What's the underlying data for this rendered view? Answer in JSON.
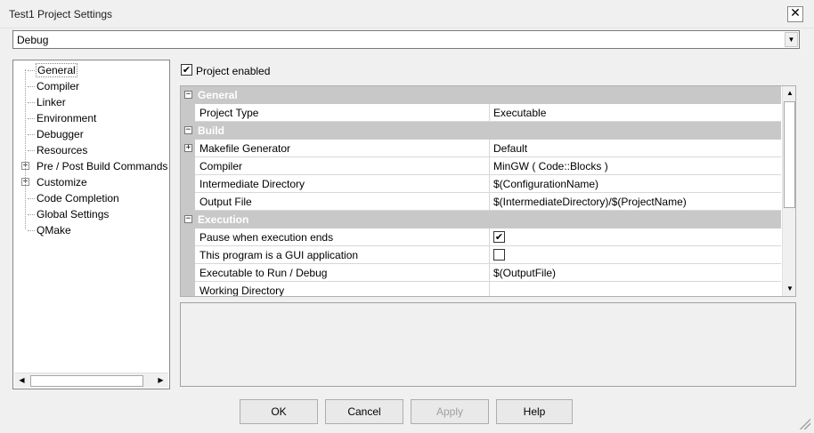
{
  "window": {
    "title": "Test1 Project Settings",
    "close_glyph": "✕"
  },
  "build_target": {
    "selected": "Debug"
  },
  "tree": {
    "items": [
      {
        "label": "General",
        "expandable": false,
        "selected": true
      },
      {
        "label": "Compiler",
        "expandable": false
      },
      {
        "label": "Linker",
        "expandable": false
      },
      {
        "label": "Environment",
        "expandable": false
      },
      {
        "label": "Debugger",
        "expandable": false
      },
      {
        "label": "Resources",
        "expandable": false
      },
      {
        "label": "Pre / Post Build Commands",
        "expandable": true
      },
      {
        "label": "Customize",
        "expandable": true
      },
      {
        "label": "Code Completion",
        "expandable": false
      },
      {
        "label": "Global Settings",
        "expandable": false
      },
      {
        "label": "QMake",
        "expandable": false
      }
    ]
  },
  "project_enabled": {
    "label": "Project enabled",
    "checked": true
  },
  "grid": {
    "rows": [
      {
        "kind": "cat",
        "name": "General",
        "toggle": "−"
      },
      {
        "kind": "prop",
        "name": "Project Type",
        "value": "Executable"
      },
      {
        "kind": "cat",
        "name": "Build",
        "toggle": "−"
      },
      {
        "kind": "prop",
        "name": "Makefile Generator",
        "value": "Default",
        "toggle": "+"
      },
      {
        "kind": "prop",
        "name": "Compiler",
        "value": "MinGW ( Code::Blocks )"
      },
      {
        "kind": "prop",
        "name": "Intermediate Directory",
        "value": "$(ConfigurationName)"
      },
      {
        "kind": "prop",
        "name": "Output File",
        "value": "$(IntermediateDirectory)/$(ProjectName)"
      },
      {
        "kind": "cat",
        "name": "Execution",
        "toggle": "−"
      },
      {
        "kind": "prop",
        "name": "Pause when execution ends",
        "checkbox": true,
        "checked": true
      },
      {
        "kind": "prop",
        "name": "This program is a GUI application",
        "checkbox": true,
        "checked": false
      },
      {
        "kind": "prop",
        "name": "Executable to Run / Debug",
        "value": "$(OutputFile)"
      },
      {
        "kind": "prop",
        "name": "Working Directory",
        "value": ""
      }
    ]
  },
  "buttons": {
    "ok": "OK",
    "cancel": "Cancel",
    "apply": "Apply",
    "help": "Help"
  },
  "icons": {
    "check": "✔",
    "scroll_up": "▲",
    "scroll_down": "▼",
    "scroll_left": "◀",
    "scroll_right": "▶",
    "combo_arrow": "▼"
  }
}
